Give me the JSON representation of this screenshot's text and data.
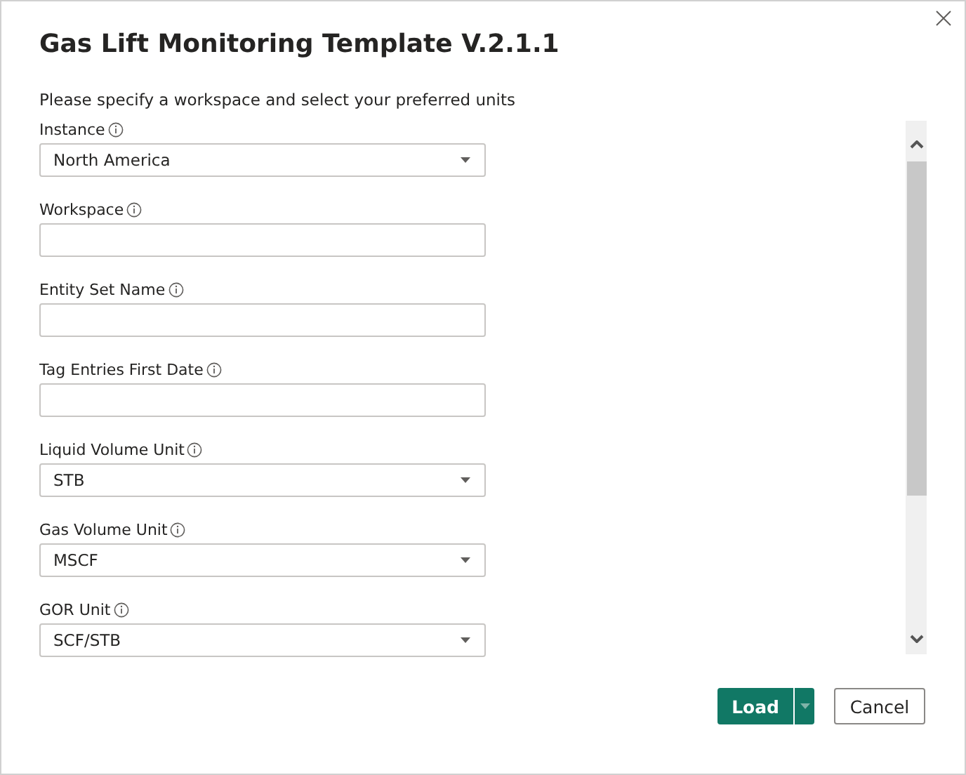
{
  "dialog": {
    "title": "Gas Lift Monitoring Template V.2.1.1",
    "subtitle": "Please specify a workspace and select your preferred units"
  },
  "fields": [
    {
      "kind": "select",
      "label": "Instance",
      "value": "North America"
    },
    {
      "kind": "text",
      "label": "Workspace"
    },
    {
      "kind": "text",
      "label": "Entity Set Name"
    },
    {
      "kind": "text",
      "label": "Tag Entries First Date"
    },
    {
      "kind": "select",
      "label": "Liquid Volume Unit",
      "value": "STB"
    },
    {
      "kind": "select",
      "label": "Gas Volume Unit",
      "value": "MSCF"
    },
    {
      "kind": "select",
      "label": "GOR Unit",
      "value": "SCF/STB"
    }
  ],
  "buttons": {
    "primary": "Load",
    "secondary": "Cancel"
  }
}
